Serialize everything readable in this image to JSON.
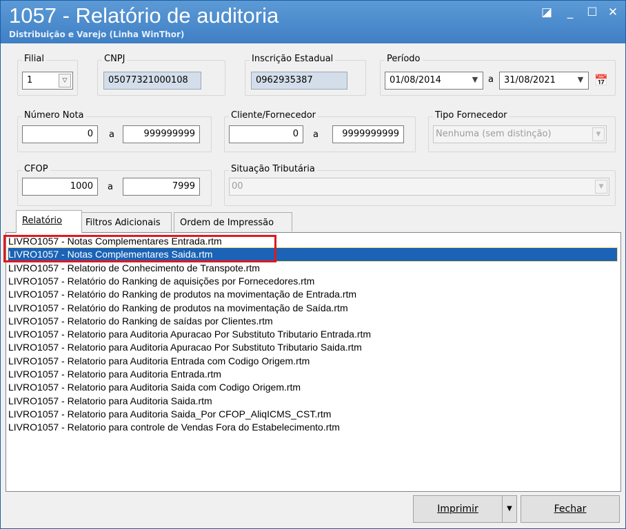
{
  "window": {
    "title": "1057 - Relatório de auditoria",
    "subtitle": "Distribuição e Varejo (Linha WinThor)",
    "restore_glyph": "◪",
    "minimize_glyph": "_",
    "maximize_glyph": "☐",
    "close_glyph": "✕"
  },
  "filial": {
    "label": "Filial",
    "value": "1"
  },
  "cnpj": {
    "label": "CNPJ",
    "value": "05077321000108"
  },
  "inscricao": {
    "label": "Inscrição Estadual",
    "value": "0962935387"
  },
  "periodo": {
    "label": "Período",
    "start": "01/08/2014",
    "sep": "a",
    "end": "31/08/2021",
    "calendar_glyph": "📅"
  },
  "numero_nota": {
    "label": "Número Nota",
    "from": "0",
    "sep": "a",
    "to": "999999999"
  },
  "cliente_fornecedor": {
    "label": "Cliente/Fornecedor",
    "from": "0",
    "sep": "a",
    "to": "9999999999"
  },
  "tipo_fornecedor": {
    "label": "Tipo Fornecedor",
    "value": "Nenhuma (sem distinção)"
  },
  "cfop": {
    "label": "CFOP",
    "from": "1000",
    "sep": "a",
    "to": "7999"
  },
  "situacao_tributaria": {
    "label": "Situação Tributária",
    "value": "00"
  },
  "tabs": [
    {
      "label": "Relatório"
    },
    {
      "label": "Filtros Adicionais"
    },
    {
      "label": "Ordem de Impressão"
    }
  ],
  "reports": [
    "LIVRO1057 - Notas Complementares Entrada.rtm",
    "LIVRO1057 - Notas Complementares Saida.rtm",
    "LIVRO1057 - Relatorio de Conhecimento de Transpote.rtm",
    "LIVRO1057 - Relatório do Ranking de aquisições por Fornecedores.rtm",
    "LIVRO1057 - Relatório do Ranking de produtos na movimentação de Entrada.rtm",
    "LIVRO1057 - Relatório do Ranking de produtos na movimentação de Saída.rtm",
    "LIVRO1057 - Relatorio do Ranking de saídas por Clientes.rtm",
    "LIVRO1057 - Relatorio para Auditoria Apuracao Por Substituto Tributario Entrada.rtm",
    "LIVRO1057 - Relatorio para Auditoria Apuracao Por Substituto Tributario Saida.rtm",
    "LIVRO1057 - Relatorio para Auditoria Entrada com Codigo Origem.rtm",
    "LIVRO1057 - Relatorio para Auditoria Entrada.rtm",
    "LIVRO1057 - Relatorio para Auditoria Saida com Codigo Origem.rtm",
    "LIVRO1057 - Relatorio para Auditoria Saida.rtm",
    "LIVRO1057 - Relatorio para Auditoria Saida_Por CFOP_AliqICMS_CST.rtm",
    "LIVRO1057 - Relatorio para controle  de Vendas Fora do Estabelecimento.rtm"
  ],
  "selected_report_index": 1,
  "buttons": {
    "imprimir": "Imprimir",
    "dropdown_glyph": "▼",
    "fechar": "Fechar"
  },
  "colors": {
    "titlebar": "#4a88cc",
    "selection": "#1a63b6",
    "highlight": "#e3171c"
  }
}
